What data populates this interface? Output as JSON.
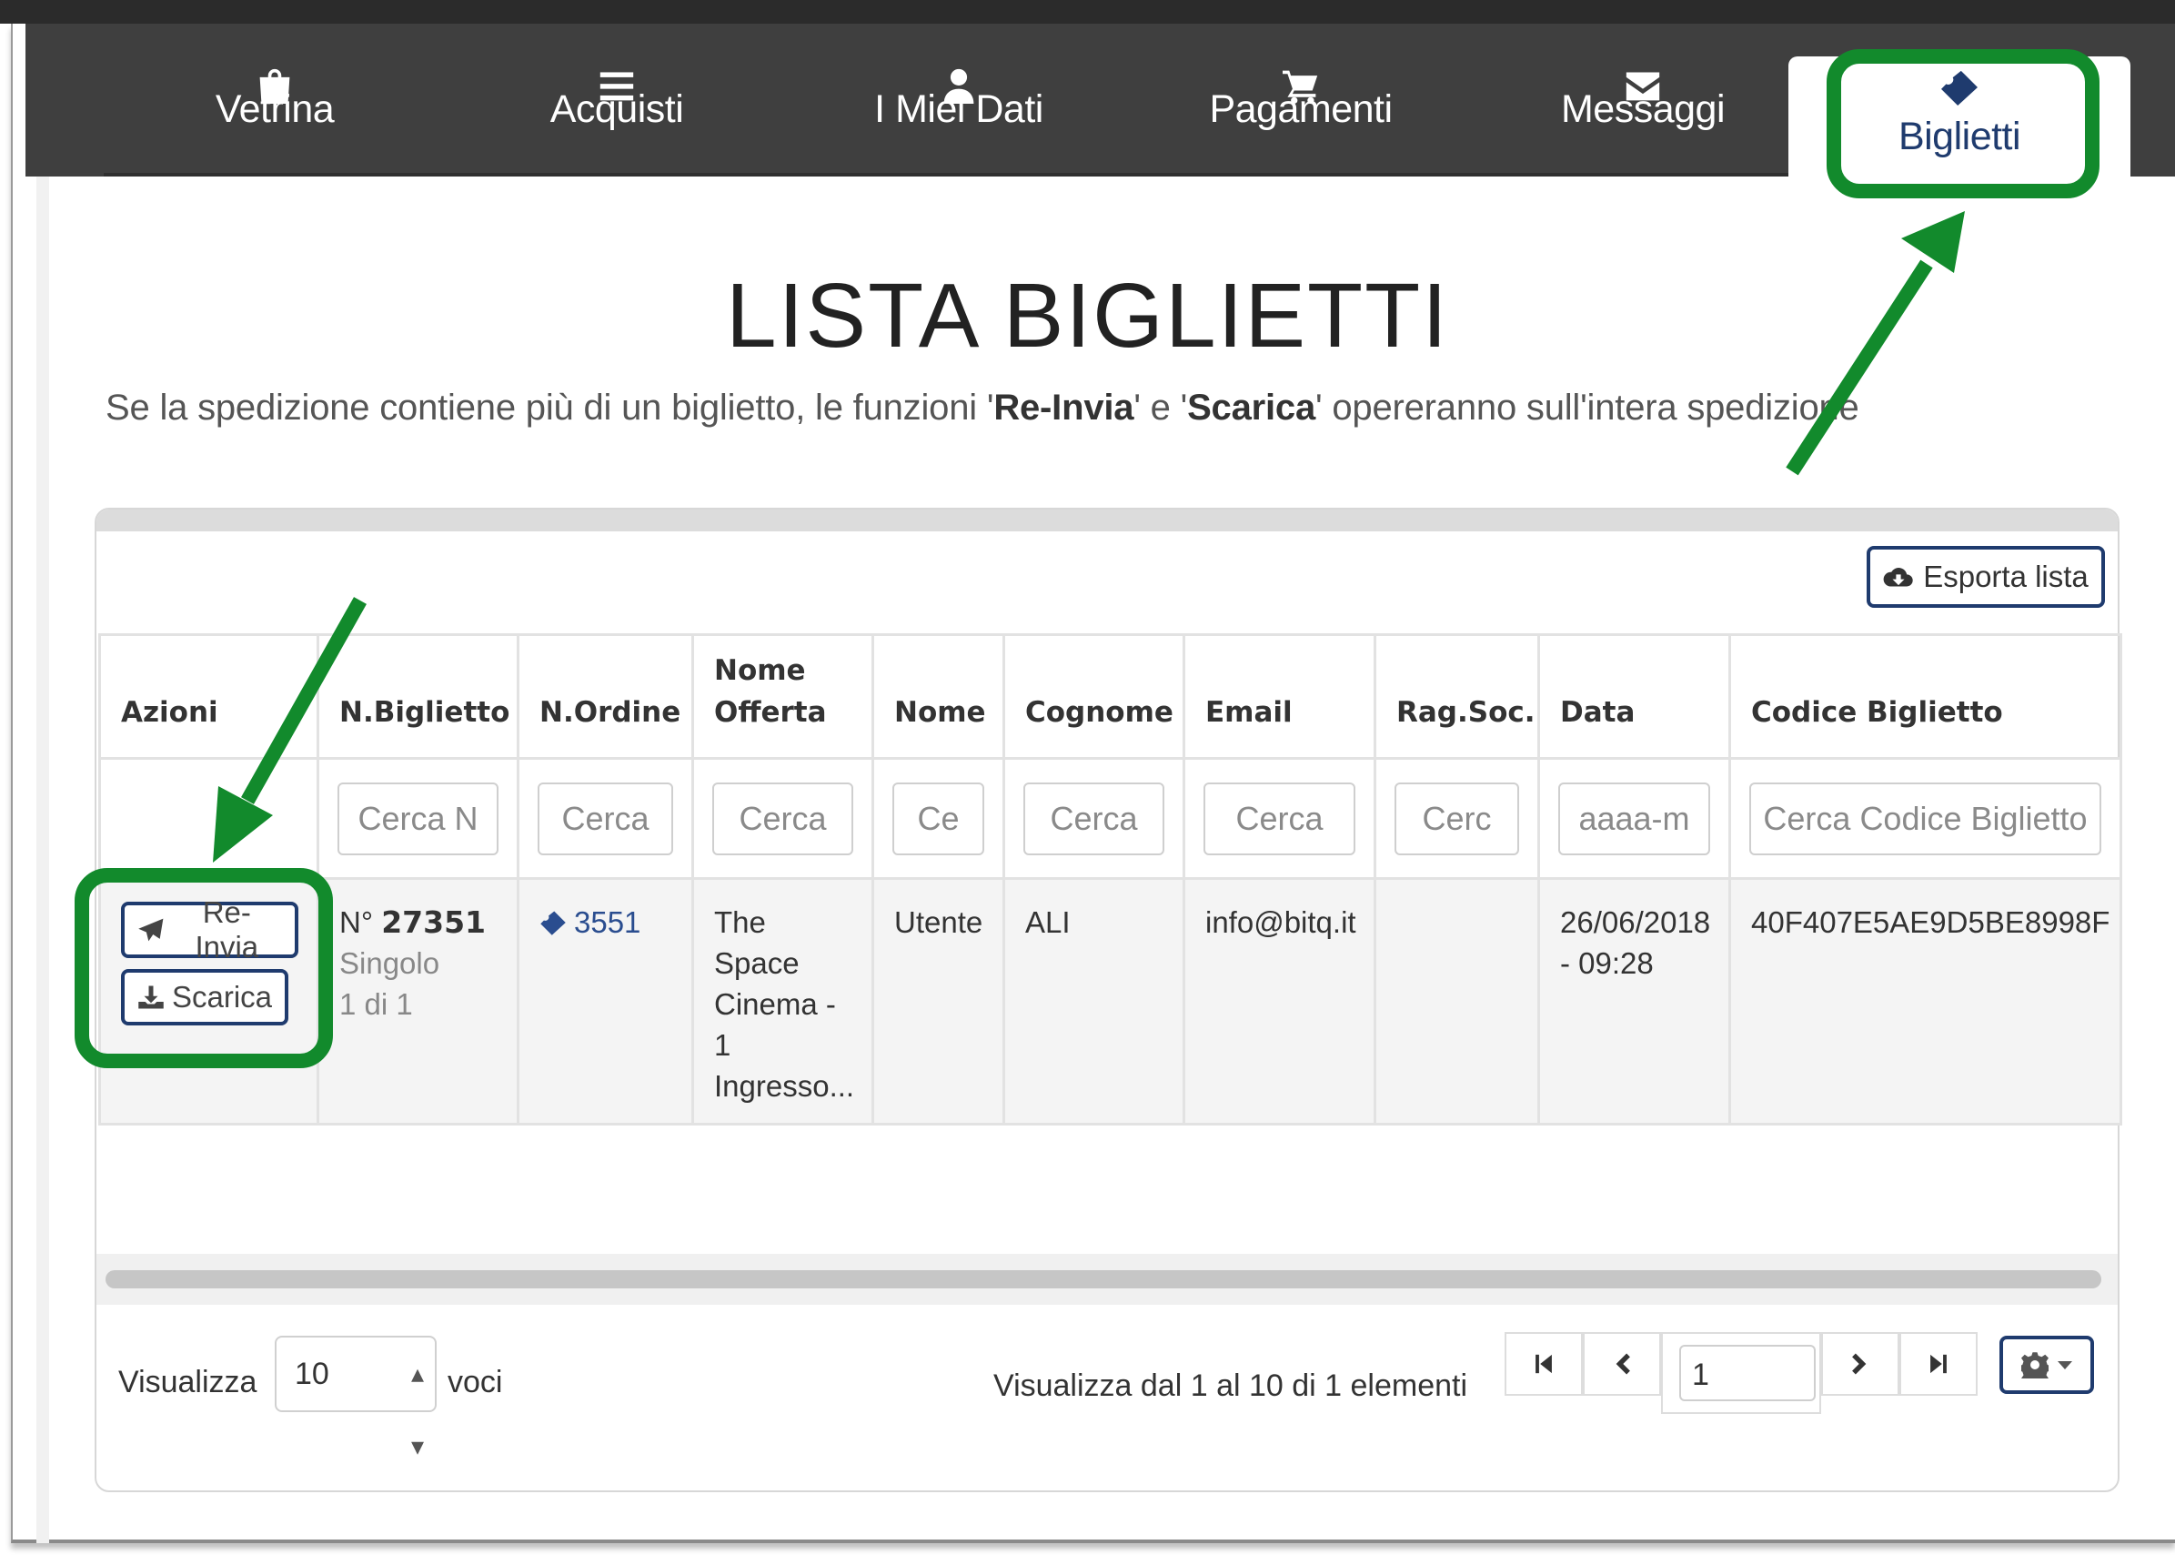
{
  "nav": {
    "items": [
      {
        "label": "Vetrina",
        "icon": "shopping-bag-icon"
      },
      {
        "label": "Acquisti",
        "icon": "list-icon"
      },
      {
        "label": "I Miei Dati",
        "icon": "user-icon"
      },
      {
        "label": "Pagamenti",
        "icon": "cart-icon"
      },
      {
        "label": "Messaggi",
        "icon": "envelope-icon"
      },
      {
        "label": "Biglietti",
        "icon": "ticket-icon",
        "active": true
      }
    ]
  },
  "header": {
    "title": "LISTA BIGLIETTI",
    "subtitle_pre": "Se la spedizione contiene più di un biglietto, le funzioni '",
    "subtitle_b1": "Re-Invia",
    "subtitle_mid": "' e '",
    "subtitle_b2": "Scarica",
    "subtitle_post": "' opereranno sull'intera spedizione"
  },
  "toolbar": {
    "export_label": "Esporta lista"
  },
  "table": {
    "columns": [
      "Azioni",
      "N.Biglietto",
      "N.Ordine",
      "Nome Offerta",
      "Nome",
      "Cognome",
      "Email",
      "Rag.Soc.",
      "Data",
      "Codice Biglietto"
    ],
    "filters": [
      "",
      "Cerca N",
      "Cerca",
      "Cerca",
      "Ce",
      "Cerca",
      "Cerca",
      "Cerc",
      "aaaa-m",
      "Cerca Codice Biglietto"
    ],
    "rows": [
      {
        "actions": {
          "resend": "Re-Invia",
          "download": "Scarica"
        },
        "ticket_prefix": "N°",
        "ticket_number": "27351",
        "ticket_type": "Singolo",
        "ticket_count": "1 di 1",
        "order": "3551",
        "offer": "The Space Cinema - 1 Ingresso...",
        "first_name": "Utente",
        "last_name": "ALI",
        "email": "info@bitq.it",
        "company": "",
        "date": "26/06/2018 - 09:28",
        "code": "40F407E5AE9D5BE8998F"
      }
    ]
  },
  "footer": {
    "show_label": "Visualizza",
    "page_size": "10",
    "entries_label": "voci",
    "info": "Visualizza dal 1 al 10 di 1 elementi",
    "current_page": "1"
  },
  "annotations": {
    "color": "#128a2c"
  }
}
